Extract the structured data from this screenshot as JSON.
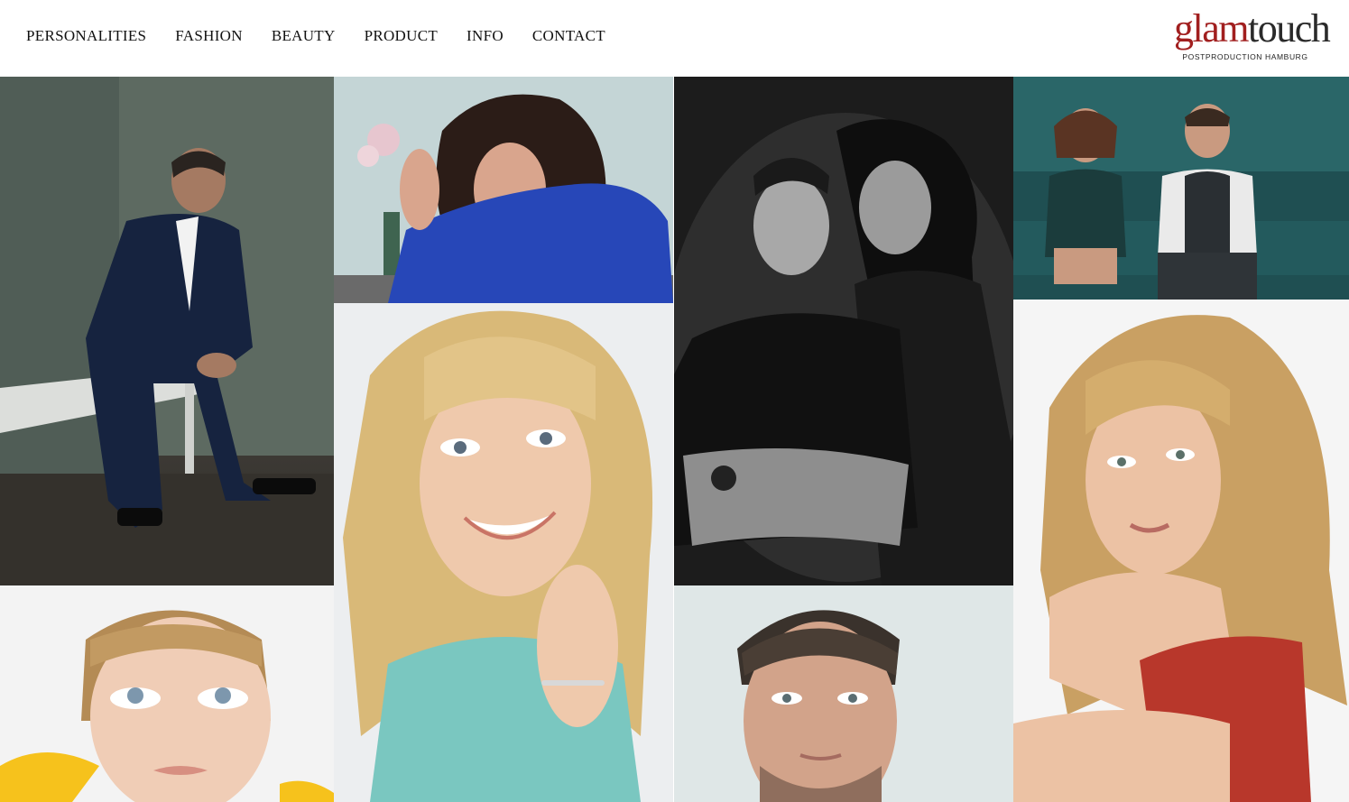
{
  "nav": {
    "items": [
      "PERSONALITIES",
      "FASHION",
      "BEAUTY",
      "PRODUCT",
      "INFO",
      "CONTACT"
    ]
  },
  "logo": {
    "glam": "glam",
    "touch": "touch",
    "subtitle": "POSTPRODUCTION HAMBURG"
  },
  "colors": {
    "logo_red": "#a11f1f",
    "text": "#111111",
    "background": "#ffffff"
  },
  "gallery": [
    {
      "id": "t1",
      "description": "Man in navy suit seated on bench"
    },
    {
      "id": "t2",
      "description": "Woman with dark curly hair in blue top"
    },
    {
      "id": "t3",
      "description": "Black and white portrait of a couple"
    },
    {
      "id": "t4",
      "description": "Couple sitting on teal sofa"
    },
    {
      "id": "t5",
      "description": "Smiling blonde woman portrait"
    },
    {
      "id": "t6",
      "description": "Blonde woman in red lace top"
    },
    {
      "id": "t7",
      "description": "Woman looking upward"
    },
    {
      "id": "t8",
      "description": "Close-up portrait of a man"
    }
  ]
}
